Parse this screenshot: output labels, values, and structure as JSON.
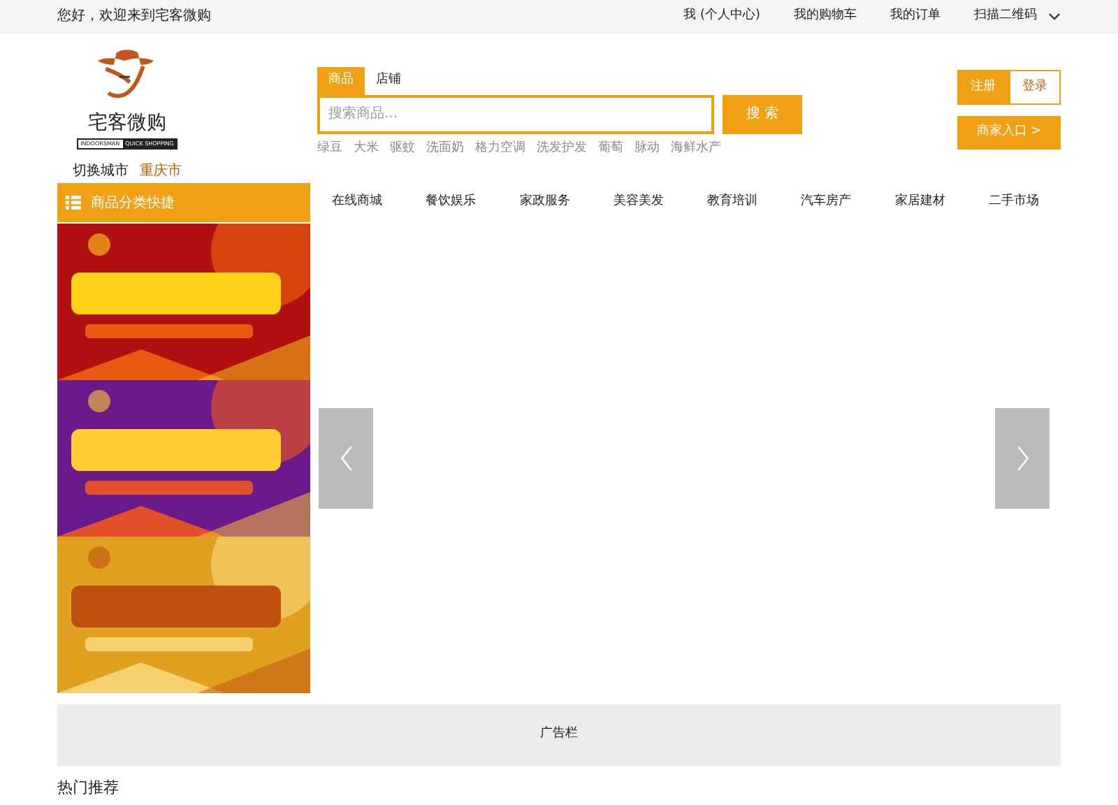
{
  "top_bar": {
    "greeting": "您好，欢迎来到宅客微购",
    "links": [
      "我 (个人中心)",
      "我的购物车",
      "我的订单",
      "扫描二维码"
    ]
  },
  "logo": {
    "name": "宅客微购",
    "tagline": [
      "INDOORSMAN",
      "QUICK SHOPPING"
    ]
  },
  "city": {
    "label": "切换城市",
    "value": "重庆市"
  },
  "search": {
    "tabs": [
      {
        "label": "商品",
        "selected": true
      },
      {
        "label": "店铺",
        "selected": false
      }
    ],
    "placeholder": "搜索商品...",
    "button": "搜 索",
    "hot_words": [
      "绿豆",
      "大米",
      "驱蚊",
      "洗面奶",
      "格力空调",
      "洗发护发",
      "葡萄",
      "脉动",
      "海鲜水产"
    ]
  },
  "account": {
    "buttons": [
      {
        "label": "注册",
        "selected": true
      },
      {
        "label": "登录",
        "selected": false
      }
    ],
    "merchant": "商家入口 >"
  },
  "category_menu": {
    "title": "商品分类快捷"
  },
  "nav": [
    "在线商城",
    "餐饮娱乐",
    "家政服务",
    "美容美发",
    "教育培训",
    "汽车房产",
    "家居建材",
    "二手市场"
  ],
  "banners": [
    {
      "kind": "picture"
    },
    {
      "kind": "picture"
    },
    {
      "kind": "picture"
    }
  ],
  "ad_bar": "广告栏",
  "section_title": "热门推荐"
}
